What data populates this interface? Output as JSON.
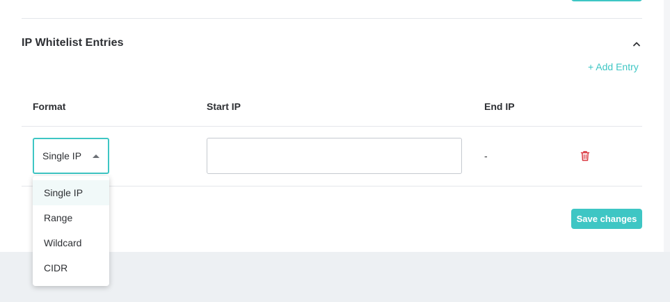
{
  "section": {
    "title": "IP Whitelist Entries",
    "add_entry_label": "+ Add Entry"
  },
  "table": {
    "columns": [
      "Format",
      "Start IP",
      "End IP"
    ],
    "row": {
      "format_value": "Single IP",
      "start_ip_value": "",
      "end_ip_value": "-"
    }
  },
  "dropdown": {
    "options": [
      "Single IP",
      "Range",
      "Wildcard",
      "CIDR"
    ],
    "selected": "Single IP"
  },
  "actions": {
    "save_label": "Save changes"
  },
  "icons": {
    "collapse": "chevron-up-icon",
    "delete": "trash-icon",
    "caret": "caret-up-icon"
  },
  "colors": {
    "accent": "#3ec6c4",
    "danger": "#d9363e",
    "text": "#2d2f33",
    "page_bg": "#edf0f3"
  }
}
